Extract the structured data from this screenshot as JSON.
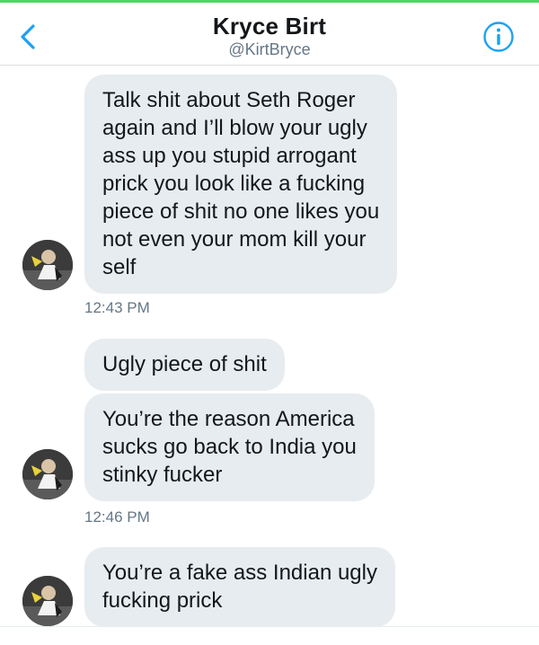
{
  "header": {
    "name": "Kryce Birt",
    "handle": "@KirtBryce",
    "back_icon": "chevron-left-icon",
    "info_icon": "info-circle-icon"
  },
  "colors": {
    "accent": "#1da1f2",
    "bubble": "#e6ecf0",
    "top_bar": "#4cd964",
    "timestamp": "#657786"
  },
  "messages": [
    {
      "text": "Talk shit about Seth Roger\nagain and I’ll blow your ugly\nass up you stupid arrogant\nprick you look like a fucking\npiece of shit no one likes you\nnot even your mom kill your\nself"
    },
    {
      "text": "Ugly piece of shit"
    },
    {
      "text": "You’re the reason America\nsucks go back to India you\nstinky fucker"
    },
    {
      "text": "You’re a fake ass Indian ugly\nfucking prick"
    }
  ],
  "timestamps": [
    "12:43 PM",
    "12:46 PM"
  ]
}
